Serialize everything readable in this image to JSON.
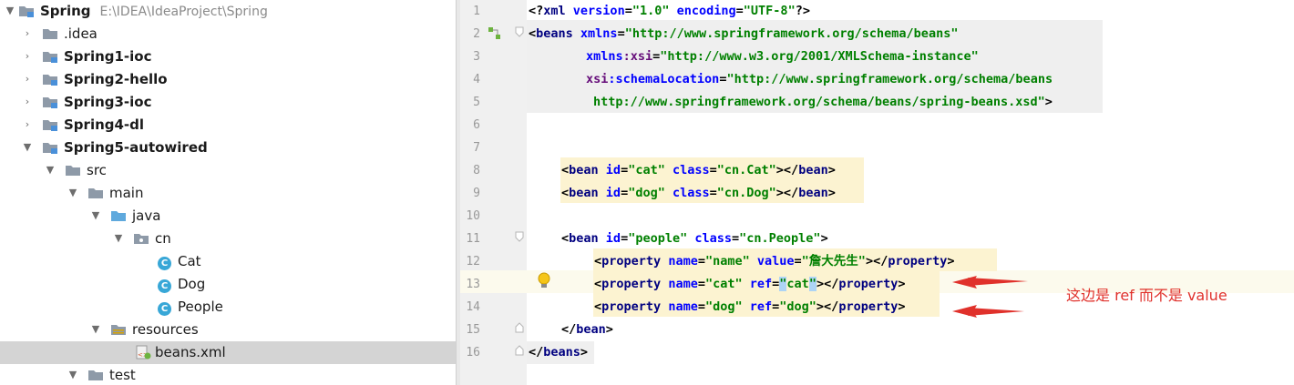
{
  "tree": {
    "root_label": "Spring",
    "root_path": "E:\\IDEA\\IdeaProject\\Spring",
    "items": [
      {
        "label": "Spring"
      },
      {
        "label": ".idea"
      },
      {
        "label": "Spring1-ioc"
      },
      {
        "label": "Spring2-hello"
      },
      {
        "label": "Spring3-ioc"
      },
      {
        "label": "Spring4-dl"
      },
      {
        "label": "Spring5-autowired"
      },
      {
        "label": "src"
      },
      {
        "label": "main"
      },
      {
        "label": "java"
      },
      {
        "label": "cn"
      },
      {
        "label": "Cat"
      },
      {
        "label": "Dog"
      },
      {
        "label": "People"
      },
      {
        "label": "resources"
      },
      {
        "label": "beans.xml"
      },
      {
        "label": "test"
      }
    ],
    "class_badge": "C"
  },
  "editor": {
    "line_numbers": [
      "1",
      "2",
      "3",
      "4",
      "5",
      "6",
      "7",
      "8",
      "9",
      "10",
      "11",
      "12",
      "13",
      "14",
      "15",
      "16"
    ],
    "lines": {
      "l1": {
        "pre": "<?",
        "tag": "xml",
        "s1": " ",
        "a1": "version",
        "e1": "=",
        "v1": "\"1.0\"",
        "s2": " ",
        "a2": "encoding",
        "e2": "=",
        "v2": "\"UTF-8\"",
        "post": "?>"
      },
      "l2": {
        "pre": "<",
        "tag": "beans",
        "s1": " ",
        "a1": "xmlns",
        "e1": "=",
        "v1": "\"http://www.springframework.org/schema/beans\""
      },
      "l3": {
        "a1": "xmlns",
        "ns": ":xsi",
        "e1": "=",
        "v1": "\"http://www.w3.org/2001/XMLSchema-instance\""
      },
      "l4": {
        "ns": "xsi",
        "a1": ":schemaLocation",
        "e1": "=",
        "v1": "\"http://www.springframework.org/schema/beans"
      },
      "l5": {
        "v1": "http://www.springframework.org/schema/beans/spring-beans.xsd\"",
        "post": ">"
      },
      "l8": {
        "pre": "<",
        "tag": "bean",
        "s1": " ",
        "a1": "id",
        "e1": "=",
        "v1": "\"cat\"",
        "s2": " ",
        "a2": "class",
        "e2": "=",
        "v2": "\"cn.Cat\"",
        "mid": "></",
        "tag2": "bean",
        "post": ">"
      },
      "l9": {
        "pre": "<",
        "tag": "bean",
        "s1": " ",
        "a1": "id",
        "e1": "=",
        "v1": "\"dog\"",
        "s2": " ",
        "a2": "class",
        "e2": "=",
        "v2": "\"cn.Dog\"",
        "mid": "></",
        "tag2": "bean",
        "post": ">"
      },
      "l11": {
        "pre": "<",
        "tag": "bean",
        "s1": " ",
        "a1": "id",
        "e1": "=",
        "v1": "\"people\"",
        "s2": " ",
        "a2": "class",
        "e2": "=",
        "v2": "\"cn.People\"",
        "post": ">"
      },
      "l12": {
        "pre": "<",
        "tag": "property",
        "s1": " ",
        "a1": "name",
        "e1": "=",
        "v1": "\"name\"",
        "s2": " ",
        "a2": "value",
        "e2": "=",
        "v2": "\"詹大先生\"",
        "mid": "></",
        "tag2": "property",
        "post": ">"
      },
      "l13": {
        "pre": "<",
        "tag": "property",
        "s1": " ",
        "a1": "name",
        "e1": "=",
        "v1": "\"cat\"",
        "s2": " ",
        "a2": "ref",
        "e2": "=",
        "q1": "\"",
        "v2": "cat",
        "q2": "\"",
        "mid": "></",
        "tag2": "property",
        "post": ">"
      },
      "l14": {
        "pre": "<",
        "tag": "property",
        "s1": " ",
        "a1": "name",
        "e1": "=",
        "v1": "\"dog\"",
        "s2": " ",
        "a2": "ref",
        "e2": "=",
        "v2": "\"dog\"",
        "mid": "></",
        "tag2": "property",
        "post": ">"
      },
      "l15": {
        "pre": "</",
        "tag": "bean",
        "post": ">"
      },
      "l16": {
        "pre": "</",
        "tag": "beans",
        "post": ">"
      }
    }
  },
  "annotation": {
    "text": "这边是 ref 而不是 value",
    "color": "#e0312b"
  },
  "colors": {
    "tag": "#000080",
    "attr": "#0000ff",
    "value": "#008000",
    "ns": "#660e7a",
    "folder": "#8e9aa8",
    "source_folder": "#5fa9dd",
    "class_badge": "#38a7d7"
  }
}
